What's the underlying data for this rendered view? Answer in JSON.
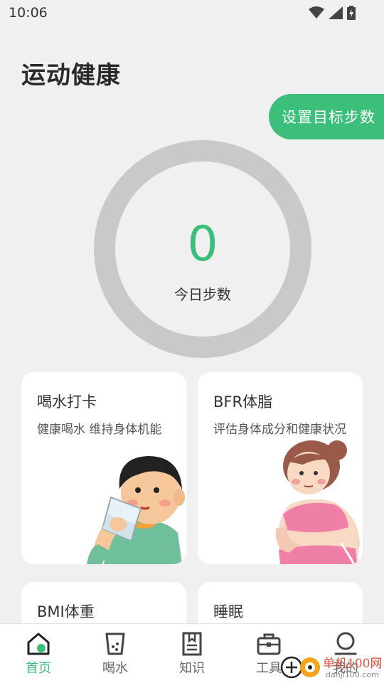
{
  "status": {
    "time": "10:06"
  },
  "page": {
    "title": "运动健康"
  },
  "goal_button": {
    "label": "设置目标步数"
  },
  "steps": {
    "count": "0",
    "label": "今日步数"
  },
  "cards": [
    {
      "title": "喝水打卡",
      "subtitle": "健康喝水 维持身体机能"
    },
    {
      "title": "BFR体脂",
      "subtitle": "评估身体成分和健康状况"
    },
    {
      "title": "BMI体重",
      "subtitle": ""
    },
    {
      "title": "睡眠",
      "subtitle": ""
    }
  ],
  "nav": [
    {
      "label": "首页",
      "icon": "home-icon",
      "active": true
    },
    {
      "label": "喝水",
      "icon": "cup-icon",
      "active": false
    },
    {
      "label": "知识",
      "icon": "book-icon",
      "active": false
    },
    {
      "label": "工具",
      "icon": "toolbox-icon",
      "active": false
    },
    {
      "label": "我的",
      "icon": "profile-icon",
      "active": false
    }
  ],
  "watermark": {
    "text": "单机100网",
    "url": "danji100.com"
  },
  "colors": {
    "accent": "#3cbf7a",
    "ring": "#c9c9c9",
    "background": "#f0f0f0"
  }
}
